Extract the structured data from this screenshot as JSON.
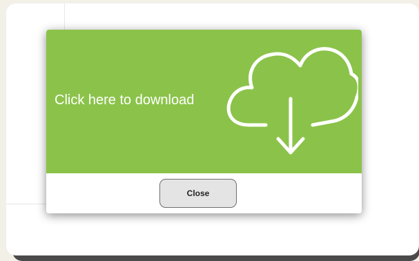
{
  "modal": {
    "download_text": "Click here to download",
    "download_icon": "cloud-download-icon",
    "close_label": "Close"
  },
  "colors": {
    "banner": "#8bc34a",
    "background": "#f2f0e7",
    "button": "#e4e4e4"
  }
}
